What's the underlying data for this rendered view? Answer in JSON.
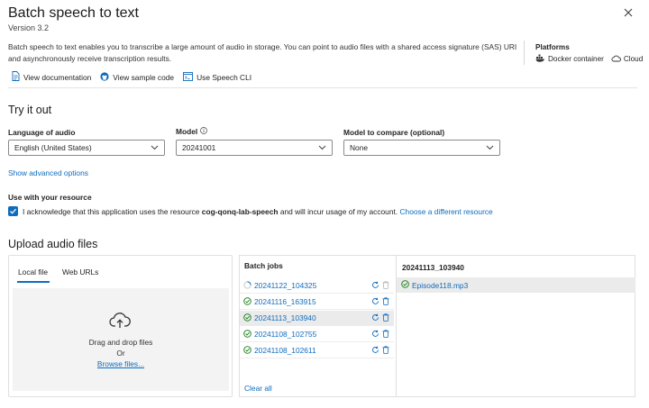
{
  "header": {
    "title": "Batch speech to text",
    "version": "Version 3.2",
    "description": "Batch speech to text enables you to transcribe a large amount of audio in storage. You can point to audio files with a shared access signature (SAS) URI and asynchronously receive transcription results."
  },
  "platforms": {
    "label": "Platforms",
    "items": [
      {
        "label": "Docker container",
        "icon": "docker-icon"
      },
      {
        "label": "Cloud",
        "icon": "cloud-icon"
      }
    ]
  },
  "links": [
    {
      "label": "View documentation",
      "icon": "document-icon"
    },
    {
      "label": "View sample code",
      "icon": "github-icon"
    },
    {
      "label": "Use Speech CLI",
      "icon": "terminal-icon"
    }
  ],
  "try_it_out": {
    "heading": "Try it out",
    "language": {
      "label": "Language of audio",
      "value": "English (United States)"
    },
    "model": {
      "label": "Model",
      "value": "20241001"
    },
    "compare": {
      "label": "Model to compare (optional)",
      "value": "None"
    },
    "advanced": "Show advanced options"
  },
  "resource": {
    "heading": "Use with your resource",
    "ack_prefix": "I acknowledge that this application uses the resource",
    "resource_name": "cog-qonq-lab-speech",
    "ack_suffix": "and will incur usage of my account.",
    "choose_link": "Choose a different resource"
  },
  "upload": {
    "heading": "Upload audio files",
    "tabs": [
      "Local file",
      "Web URLs"
    ],
    "drag_text": "Drag and drop files",
    "or_text": "Or",
    "browse": "Browse files..."
  },
  "batch_jobs": {
    "heading": "Batch jobs",
    "jobs": [
      {
        "name": "20241122_104325",
        "status": "running"
      },
      {
        "name": "20241116_163915",
        "status": "succeeded"
      },
      {
        "name": "20241113_103940",
        "status": "succeeded"
      },
      {
        "name": "20241108_102755",
        "status": "succeeded"
      },
      {
        "name": "20241108_102611",
        "status": "succeeded"
      }
    ],
    "clear_all": "Clear all"
  },
  "job_detail": {
    "heading": "20241113_103940",
    "files": [
      {
        "name": "Episode118.mp3",
        "status": "succeeded"
      }
    ]
  },
  "colors": {
    "accent": "#0f6cbd",
    "success": "#107c10"
  }
}
